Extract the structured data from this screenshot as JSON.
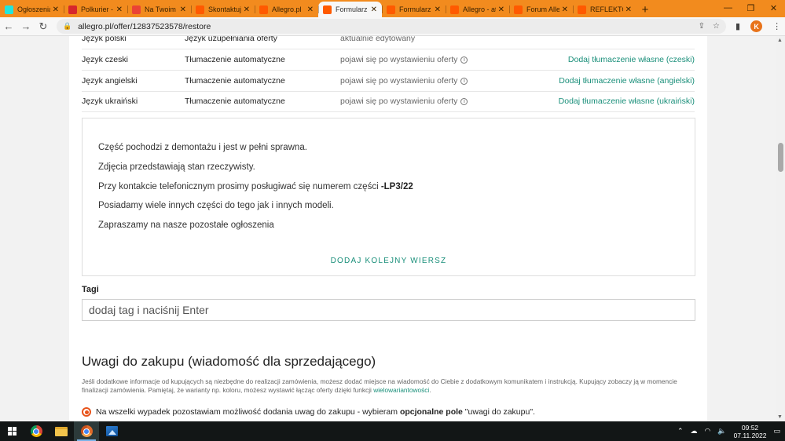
{
  "browser": {
    "tabs": [
      {
        "label": "Ogłoszenia",
        "icon": "olx-icon",
        "color": "#23e5db",
        "active": false
      },
      {
        "label": "Polkurier -",
        "icon": "polkurier-icon",
        "color": "#d6262c",
        "active": false
      },
      {
        "label": "Na Twoim k",
        "icon": "gmail-icon",
        "color": "#ea4335",
        "active": false
      },
      {
        "label": "Skontaktuj",
        "icon": "allegro-icon",
        "color": "#ff5a00",
        "active": false
      },
      {
        "label": "Allegro.pl",
        "icon": "allegro-icon",
        "color": "#ff5a00",
        "active": false
      },
      {
        "label": "Formularz",
        "icon": "allegro-icon",
        "color": "#ff5a00",
        "active": true
      },
      {
        "label": "Formularz",
        "icon": "allegro-icon",
        "color": "#ff5a00",
        "active": false
      },
      {
        "label": "Allegro - at",
        "icon": "allegro-icon",
        "color": "#ff5a00",
        "active": false
      },
      {
        "label": "Forum Alleg",
        "icon": "forum-icon",
        "color": "#ff5a00",
        "active": false
      },
      {
        "label": "REFLEKTOR",
        "icon": "allegro-icon",
        "color": "#ff5a00",
        "active": false
      }
    ],
    "url": "allegro.pl/offer/12837523578/restore",
    "profile_initial": "K"
  },
  "languages": [
    {
      "lang": "Język polski",
      "type": "Język uzupełniania oferty",
      "status": "aktualnie edytowany",
      "has_info": false,
      "action": ""
    },
    {
      "lang": "Język czeski",
      "type": "Tłumaczenie automatyczne",
      "status": "pojawi się po wystawieniu oferty",
      "has_info": true,
      "action": "Dodaj tłumaczenie własne (czeski)"
    },
    {
      "lang": "Język angielski",
      "type": "Tłumaczenie automatyczne",
      "status": "pojawi się po wystawieniu oferty",
      "has_info": true,
      "action": "Dodaj tłumaczenie własne (angielski)"
    },
    {
      "lang": "Język ukraiński",
      "type": "Tłumaczenie automatyczne",
      "status": "pojawi się po wystawieniu oferty",
      "has_info": true,
      "action": "Dodaj tłumaczenie własne (ukraiński)"
    }
  ],
  "description": {
    "line1": "Część pochodzi z demontażu i jest w pełni sprawna.",
    "line2": "Zdjęcia przedstawiają stan rzeczywisty.",
    "line3_prefix": "Przy kontakcie telefonicznym prosimy posługiwać się numerem części ",
    "line3_bold": "-LP3/22",
    "line4": "Posiadamy wiele innych części do tego jak i innych modeli.",
    "line5": "Zapraszamy na nasze pozostałe ogłoszenia",
    "add_row": "DODAJ KOLEJNY WIERSZ"
  },
  "tags": {
    "label": "Tagi",
    "placeholder": "dodaj tag i naciśnij Enter"
  },
  "remarks": {
    "title": "Uwagi do zakupu (wiadomość dla sprzedającego)",
    "note": "Jeśli dodatkowe informacje od kupujących są niezbędne do realizacji zamówienia, możesz dodać miejsce na wiadomość do Ciebie z dodatkowym komunikatem i instrukcją. Kupujący zobaczy ją w momencie finalizacji zamówienia. Pamiętaj, że warianty np. koloru, możesz wystawić łącząc oferty dzięki funkcji ",
    "note_link": "wielowariantowości",
    "note_end": ".",
    "option_prefix": "Na wszelki wypadek pozostawiam możliwość dodania uwag do zakupu - wybieram ",
    "option_bold": "opcjonalne pole",
    "option_suffix": " \"uwagi do zakupu\"."
  },
  "taskbar": {
    "time": "09:52",
    "date": "07.11.2022"
  }
}
